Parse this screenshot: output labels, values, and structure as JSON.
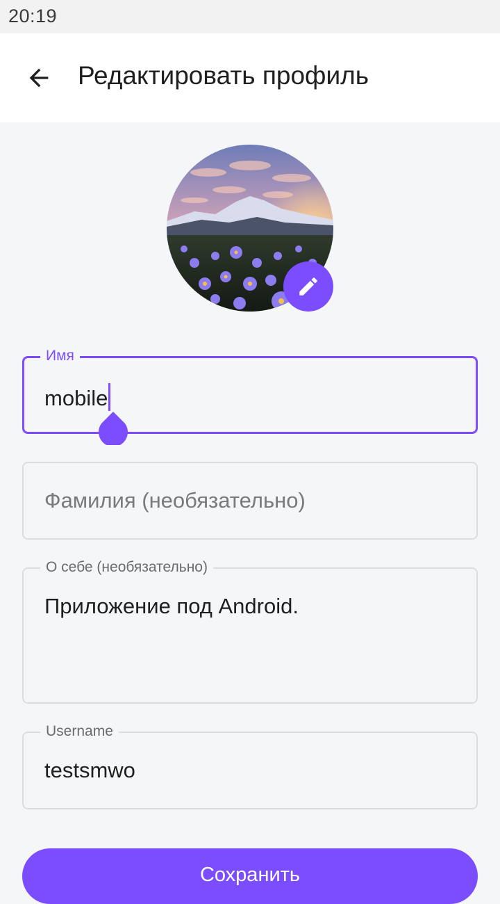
{
  "status_bar": {
    "time": "20:19"
  },
  "app_bar": {
    "title": "Редактировать профиль",
    "back_icon": "arrow-back-icon"
  },
  "avatar": {
    "edit_icon": "pencil-icon"
  },
  "fields": {
    "first_name": {
      "label": "Имя",
      "value": "mobile"
    },
    "last_name": {
      "placeholder": "Фамилия (необязательно)"
    },
    "about": {
      "label": "О себе (необязательно)",
      "value": "Приложение под Android."
    },
    "username": {
      "label": "Username",
      "value": "testsmwo"
    }
  },
  "save_button": {
    "label": "Сохранить"
  },
  "colors": {
    "accent": "#7c4dff",
    "border": "#dcdde0",
    "background": "#f5f6f8"
  }
}
